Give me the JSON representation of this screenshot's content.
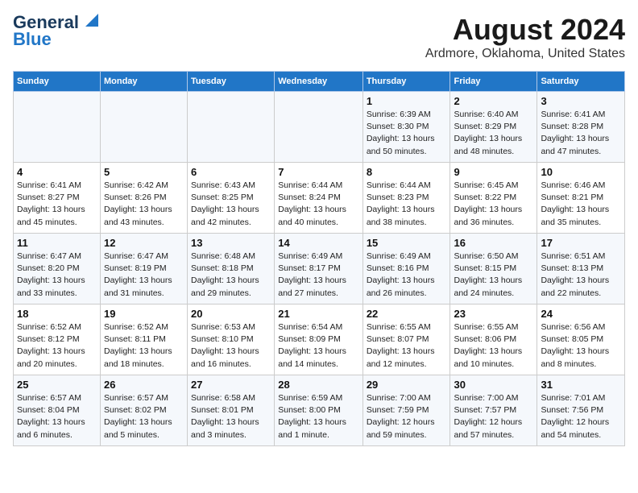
{
  "header": {
    "logo_line1": "General",
    "logo_line2": "Blue",
    "title": "August 2024",
    "subtitle": "Ardmore, Oklahoma, United States"
  },
  "columns": [
    "Sunday",
    "Monday",
    "Tuesday",
    "Wednesday",
    "Thursday",
    "Friday",
    "Saturday"
  ],
  "weeks": [
    [
      {
        "day": "",
        "info": ""
      },
      {
        "day": "",
        "info": ""
      },
      {
        "day": "",
        "info": ""
      },
      {
        "day": "",
        "info": ""
      },
      {
        "day": "1",
        "info": "Sunrise: 6:39 AM\nSunset: 8:30 PM\nDaylight: 13 hours\nand 50 minutes."
      },
      {
        "day": "2",
        "info": "Sunrise: 6:40 AM\nSunset: 8:29 PM\nDaylight: 13 hours\nand 48 minutes."
      },
      {
        "day": "3",
        "info": "Sunrise: 6:41 AM\nSunset: 8:28 PM\nDaylight: 13 hours\nand 47 minutes."
      }
    ],
    [
      {
        "day": "4",
        "info": "Sunrise: 6:41 AM\nSunset: 8:27 PM\nDaylight: 13 hours\nand 45 minutes."
      },
      {
        "day": "5",
        "info": "Sunrise: 6:42 AM\nSunset: 8:26 PM\nDaylight: 13 hours\nand 43 minutes."
      },
      {
        "day": "6",
        "info": "Sunrise: 6:43 AM\nSunset: 8:25 PM\nDaylight: 13 hours\nand 42 minutes."
      },
      {
        "day": "7",
        "info": "Sunrise: 6:44 AM\nSunset: 8:24 PM\nDaylight: 13 hours\nand 40 minutes."
      },
      {
        "day": "8",
        "info": "Sunrise: 6:44 AM\nSunset: 8:23 PM\nDaylight: 13 hours\nand 38 minutes."
      },
      {
        "day": "9",
        "info": "Sunrise: 6:45 AM\nSunset: 8:22 PM\nDaylight: 13 hours\nand 36 minutes."
      },
      {
        "day": "10",
        "info": "Sunrise: 6:46 AM\nSunset: 8:21 PM\nDaylight: 13 hours\nand 35 minutes."
      }
    ],
    [
      {
        "day": "11",
        "info": "Sunrise: 6:47 AM\nSunset: 8:20 PM\nDaylight: 13 hours\nand 33 minutes."
      },
      {
        "day": "12",
        "info": "Sunrise: 6:47 AM\nSunset: 8:19 PM\nDaylight: 13 hours\nand 31 minutes."
      },
      {
        "day": "13",
        "info": "Sunrise: 6:48 AM\nSunset: 8:18 PM\nDaylight: 13 hours\nand 29 minutes."
      },
      {
        "day": "14",
        "info": "Sunrise: 6:49 AM\nSunset: 8:17 PM\nDaylight: 13 hours\nand 27 minutes."
      },
      {
        "day": "15",
        "info": "Sunrise: 6:49 AM\nSunset: 8:16 PM\nDaylight: 13 hours\nand 26 minutes."
      },
      {
        "day": "16",
        "info": "Sunrise: 6:50 AM\nSunset: 8:15 PM\nDaylight: 13 hours\nand 24 minutes."
      },
      {
        "day": "17",
        "info": "Sunrise: 6:51 AM\nSunset: 8:13 PM\nDaylight: 13 hours\nand 22 minutes."
      }
    ],
    [
      {
        "day": "18",
        "info": "Sunrise: 6:52 AM\nSunset: 8:12 PM\nDaylight: 13 hours\nand 20 minutes."
      },
      {
        "day": "19",
        "info": "Sunrise: 6:52 AM\nSunset: 8:11 PM\nDaylight: 13 hours\nand 18 minutes."
      },
      {
        "day": "20",
        "info": "Sunrise: 6:53 AM\nSunset: 8:10 PM\nDaylight: 13 hours\nand 16 minutes."
      },
      {
        "day": "21",
        "info": "Sunrise: 6:54 AM\nSunset: 8:09 PM\nDaylight: 13 hours\nand 14 minutes."
      },
      {
        "day": "22",
        "info": "Sunrise: 6:55 AM\nSunset: 8:07 PM\nDaylight: 13 hours\nand 12 minutes."
      },
      {
        "day": "23",
        "info": "Sunrise: 6:55 AM\nSunset: 8:06 PM\nDaylight: 13 hours\nand 10 minutes."
      },
      {
        "day": "24",
        "info": "Sunrise: 6:56 AM\nSunset: 8:05 PM\nDaylight: 13 hours\nand 8 minutes."
      }
    ],
    [
      {
        "day": "25",
        "info": "Sunrise: 6:57 AM\nSunset: 8:04 PM\nDaylight: 13 hours\nand 6 minutes."
      },
      {
        "day": "26",
        "info": "Sunrise: 6:57 AM\nSunset: 8:02 PM\nDaylight: 13 hours\nand 5 minutes."
      },
      {
        "day": "27",
        "info": "Sunrise: 6:58 AM\nSunset: 8:01 PM\nDaylight: 13 hours\nand 3 minutes."
      },
      {
        "day": "28",
        "info": "Sunrise: 6:59 AM\nSunset: 8:00 PM\nDaylight: 13 hours\nand 1 minute."
      },
      {
        "day": "29",
        "info": "Sunrise: 7:00 AM\nSunset: 7:59 PM\nDaylight: 12 hours\nand 59 minutes."
      },
      {
        "day": "30",
        "info": "Sunrise: 7:00 AM\nSunset: 7:57 PM\nDaylight: 12 hours\nand 57 minutes."
      },
      {
        "day": "31",
        "info": "Sunrise: 7:01 AM\nSunset: 7:56 PM\nDaylight: 12 hours\nand 54 minutes."
      }
    ]
  ]
}
